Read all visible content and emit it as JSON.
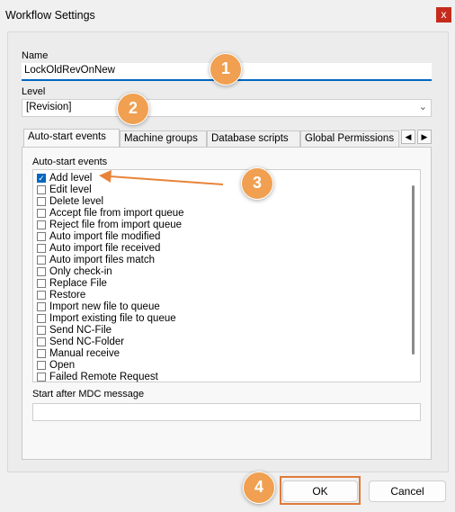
{
  "window": {
    "title": "Workflow Settings",
    "close_label": "x"
  },
  "name": {
    "label": "Name",
    "value": "LockOldRevOnNew"
  },
  "level": {
    "label": "Level",
    "value": "[Revision]"
  },
  "tabs": [
    {
      "label": "Auto-start events"
    },
    {
      "label": "Machine groups"
    },
    {
      "label": "Database scripts"
    },
    {
      "label": "Global Permissions"
    }
  ],
  "autostart": {
    "group_label": "Auto-start events",
    "events": [
      {
        "label": "Add level",
        "checked": true
      },
      {
        "label": "Edit level",
        "checked": false
      },
      {
        "label": "Delete level",
        "checked": false
      },
      {
        "label": "Accept file from import queue",
        "checked": false
      },
      {
        "label": "Reject file from import queue",
        "checked": false
      },
      {
        "label": "Auto import file modified",
        "checked": false
      },
      {
        "label": "Auto import file received",
        "checked": false
      },
      {
        "label": "Auto import files match",
        "checked": false
      },
      {
        "label": "Only check-in",
        "checked": false
      },
      {
        "label": "Replace File",
        "checked": false
      },
      {
        "label": "Restore",
        "checked": false
      },
      {
        "label": "Import new file to queue",
        "checked": false
      },
      {
        "label": "Import existing file to queue",
        "checked": false
      },
      {
        "label": "Send NC-File",
        "checked": false
      },
      {
        "label": "Send NC-Folder",
        "checked": false
      },
      {
        "label": "Manual receive",
        "checked": false
      },
      {
        "label": "Open",
        "checked": false
      },
      {
        "label": "Failed Remote Request",
        "checked": false
      }
    ],
    "mdc_label": "Start after MDC message",
    "mdc_value": ""
  },
  "buttons": {
    "ok": "OK",
    "cancel": "Cancel"
  },
  "callouts": [
    "1",
    "2",
    "3",
    "4"
  ],
  "colors": {
    "accent": "#0067c0",
    "callout": "#f0a050",
    "highlight": "#e07a3a",
    "close": "#c42b1c"
  }
}
